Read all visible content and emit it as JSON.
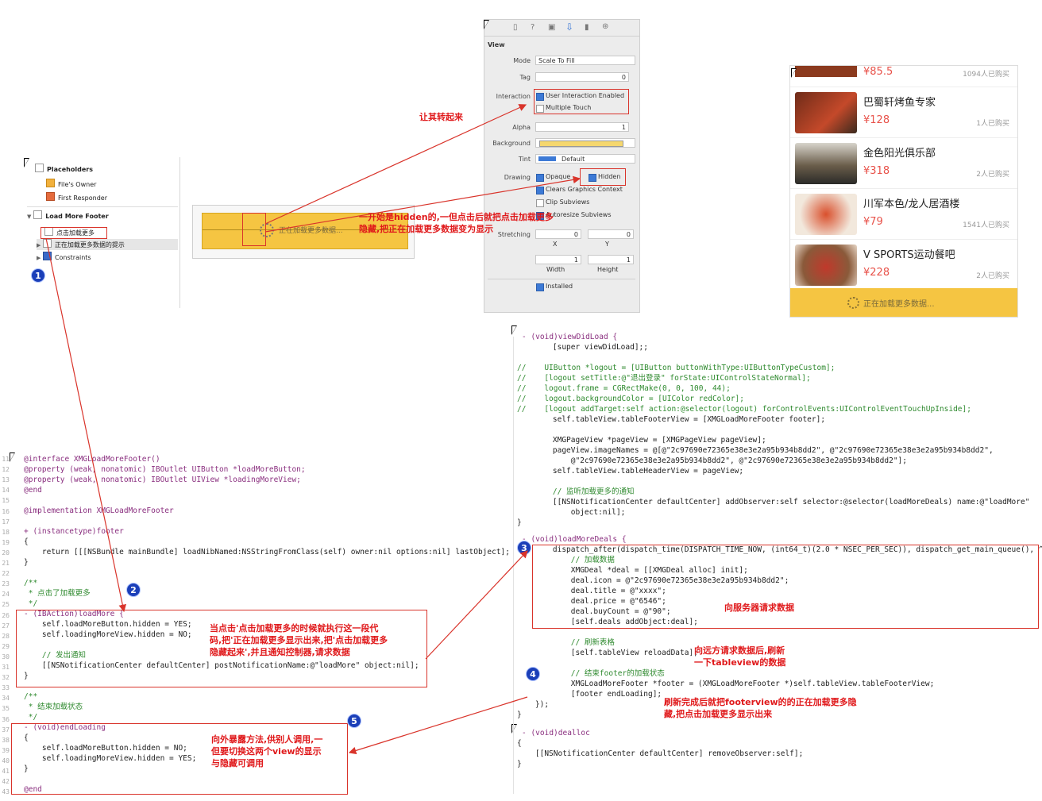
{
  "outline": {
    "placeholders": "Placeholders",
    "files_owner": "File's Owner",
    "first_responder": "First Responder",
    "footer": "Load More Footer",
    "item_button": "点击加载更多",
    "item_loading": "正在加载更多数据的提示",
    "constraints": "Constraints",
    "canvas_text": "正在加载更多数据..."
  },
  "inspector": {
    "section": "View",
    "mode_label": "Mode",
    "mode_value": "Scale To Fill",
    "tag_label": "Tag",
    "tag_value": "0",
    "interaction_label": "Interaction",
    "user_interaction": "User Interaction Enabled",
    "multiple_touch": "Multiple Touch",
    "alpha_label": "Alpha",
    "alpha_value": "1",
    "background_label": "Background",
    "tint_label": "Tint",
    "tint_value": "Default",
    "drawing_label": "Drawing",
    "opaque": "Opaque",
    "hidden": "Hidden",
    "clears": "Clears Graphics Context",
    "clip": "Clip Subviews",
    "autoresize": "Autoresize Subviews",
    "stretching_label": "Stretching",
    "x_value": "0",
    "y_value": "0",
    "x_label": "X",
    "y_label": "Y",
    "w_value": "1",
    "h_value": "1",
    "width_label": "Width",
    "height_label": "Height",
    "installed": "Installed",
    "accent_color": "#3d7ad6",
    "background_swatch": "#f5d76e"
  },
  "phone": {
    "rows": [
      {
        "name": "",
        "price": "¥85.5",
        "sold": "1094人已购买"
      },
      {
        "name": "巴蜀轩烤鱼专家",
        "price": "¥128",
        "sold": "1人已购买"
      },
      {
        "name": "金色阳光俱乐部",
        "price": "¥318",
        "sold": "2人已购买"
      },
      {
        "name": "川军本色/龙人居酒楼",
        "price": "¥79",
        "sold": "1541人已购买"
      },
      {
        "name": "V SPORTS运动餐吧",
        "price": "¥228",
        "sold": "2人已购买"
      }
    ],
    "footer_text": "正在加载更多数据...",
    "footer_color": "#f5c542"
  },
  "notes": {
    "rotate": "让其转起来",
    "hidden_note_1": "一开始是hidden的,一但点击后就把点击加载更多",
    "hidden_note_2": "隐藏,把正在加载更多数据变为显示",
    "click_note_1": "当点击'点击加载更多的时候就执行这一段代",
    "click_note_2": "码,把'正在加载更多显示出来,把'点击加载更多",
    "click_note_3": "隐藏起来',并且通知控制器,请求数据",
    "request": "向服务器请求数据",
    "refresh_1": "向远方请求数据后,刷新",
    "refresh_2": "一下tableview的数据",
    "footer_note_1": "刷新完成后就把footerview的的正在加载更多隐",
    "footer_note_2": "藏,把点击加载更多显示出来",
    "expose_1": "向外暴露方法,供别人调用,一",
    "expose_2": "但要切换这两个view的显示",
    "expose_3": "与隐藏可调用",
    "annotation_color": "#e0191b"
  },
  "badges": [
    "1",
    "2",
    "3",
    "4",
    "5"
  ],
  "code_left": {
    "line_numbers": [
      "11",
      "12",
      "13",
      "14",
      "15",
      "16",
      "17",
      "18",
      "19",
      "20",
      "21",
      "22",
      "23",
      "24",
      "25",
      "26",
      "27",
      "28",
      "29",
      "30",
      "31",
      "32",
      "33",
      "34",
      "35",
      "36",
      "37",
      "38",
      "39",
      "40",
      "41",
      "42",
      "43"
    ],
    "l1": "@interface XMGLoadMoreFooter()",
    "l2": "@property (weak, nonatomic) IBOutlet UIButton *loadMoreButton;",
    "l3": "@property (weak, nonatomic) IBOutlet UIView *loadingMoreView;",
    "l4": "@end",
    "l5": "@implementation XMGLoadMoreFooter",
    "l6": "+ (instancetype)footer",
    "l7": "{",
    "l8": "    return [[[NSBundle mainBundle] loadNibNamed:NSStringFromClass(self) owner:nil options:nil] lastObject];",
    "l9": "}",
    "l10": "/**",
    "l11": " * 点击了加载更多",
    "l12": " */",
    "l13": "- (IBAction)loadMore {",
    "l14": "    self.loadMoreButton.hidden = YES;",
    "l15": "    self.loadingMoreView.hidden = NO;",
    "l16": "    // 发出通知",
    "l17": "    [[NSNotificationCenter defaultCenter] postNotificationName:@\"loadMore\" object:nil];",
    "l18": "}",
    "l19": "/**",
    "l20": " * 结束加载状态",
    "l21": " */",
    "l22": "- (void)endLoading",
    "l23": "{",
    "l24": "    self.loadMoreButton.hidden = NO;",
    "l25": "    self.loadingMoreView.hidden = YES;",
    "l26": "}",
    "l27": "@end"
  },
  "code_right": {
    "r1": "- (void)viewDidLoad {",
    "r2": "    [super viewDidLoad];;",
    "r3": "//    UIButton *logout = [UIButton buttonWithType:UIButtonTypeCustom];",
    "r4": "//    [logout setTitle:@\"退出登录\" forState:UIControlStateNormal];",
    "r5": "//    logout.frame = CGRectMake(0, 0, 100, 44);",
    "r6": "//    logout.backgroundColor = [UIColor redColor];",
    "r7": "//    [logout addTarget:self action:@selector(logout) forControlEvents:UIControlEventTouchUpInside];",
    "r8": "    self.tableView.tableFooterView = [XMGLoadMoreFooter footer];",
    "r9": "    XMGPageView *pageView = [XMGPageView pageView];",
    "r10": "    pageView.imageNames = @[@\"2c97690e72365e38e3e2a95b934b8dd2\", @\"2c97690e72365e38e3e2a95b934b8dd2\",",
    "r11": "        @\"2c97690e72365e38e3e2a95b934b8dd2\", @\"2c97690e72365e38e3e2a95b934b8dd2\"];",
    "r12": "    self.tableView.tableHeaderView = pageView;",
    "r13": "    // 监听加载更多的通知",
    "r14": "    [[NSNotificationCenter defaultCenter] addObserver:self selector:@selector(loadMoreDeals) name:@\"loadMore\"",
    "r15": "        object:nil];",
    "r16": "}",
    "r17": "- (void)loadMoreDeals {",
    "r18": "    dispatch_after(dispatch_time(DISPATCH_TIME_NOW, (int64_t)(2.0 * NSEC_PER_SEC)), dispatch_get_main_queue(), ^{",
    "r19": "        // 加载数据",
    "r20": "        XMGDeal *deal = [[XMGDeal alloc] init];",
    "r21": "        deal.icon = @\"2c97690e72365e38e3e2a95b934b8dd2\";",
    "r22": "        deal.title = @\"xxxx\";",
    "r23": "        deal.price = @\"6546\";",
    "r24": "        deal.buyCount = @\"90\";",
    "r25": "        [self.deals addObject:deal];",
    "r26": "        // 刷新表格",
    "r27": "        [self.tableView reloadData];",
    "r28": "        // 结束footer的加载状态",
    "r29": "        XMGLoadMoreFooter *footer = (XMGLoadMoreFooter *)self.tableView.tableFooterView;",
    "r30": "        [footer endLoading];",
    "r31": "    });",
    "r32": "}",
    "r33": "- (void)dealloc",
    "r34": "{",
    "r35": "    [[NSNotificationCenter defaultCenter] removeObserver:self];",
    "r36": "}"
  }
}
